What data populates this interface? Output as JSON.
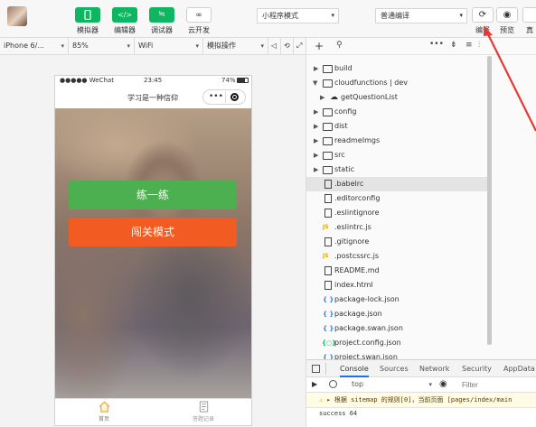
{
  "toolbar": {
    "buttons": [
      {
        "label": "模拟器",
        "icon": "phone-icon"
      },
      {
        "label": "编辑器",
        "icon": "code-icon"
      },
      {
        "label": "调试器",
        "icon": "debug-icon"
      },
      {
        "label": "云开发",
        "icon": "cloud-icon"
      }
    ],
    "mode_select": "小程序模式",
    "compile_select": "普通编译",
    "compile_label": "编译",
    "preview_label": "预览",
    "more_label": "真"
  },
  "subbar": {
    "device": "iPhone 6/...",
    "zoom": "85%",
    "network": "WiFi",
    "operation": "模拟操作"
  },
  "phone": {
    "status": {
      "carrier": "●●●●● WeChat",
      "time": "23:45",
      "battery": "74%"
    },
    "title": "学习是一种信仰",
    "capsule_dots": "•••",
    "buttons": [
      {
        "label": "练一练",
        "color": "#4caf50"
      },
      {
        "label": "闯关模式",
        "color": "#f25b22"
      }
    ],
    "tabs": [
      {
        "label": "首页",
        "icon": "home-icon"
      },
      {
        "label": "答题记录",
        "icon": "record-icon"
      }
    ]
  },
  "filetree": {
    "items": [
      {
        "name": "build",
        "type": "folder"
      },
      {
        "name": "cloudfunctions | dev",
        "type": "cloud-folder",
        "expanded": true
      },
      {
        "name": "getQuestionList",
        "type": "cloud-folder-child"
      },
      {
        "name": "config",
        "type": "folder"
      },
      {
        "name": "dist",
        "type": "folder"
      },
      {
        "name": "readmeImgs",
        "type": "folder"
      },
      {
        "name": "src",
        "type": "folder"
      },
      {
        "name": "static",
        "type": "folder"
      },
      {
        "name": ".babelrc",
        "type": "file",
        "selected": true
      },
      {
        "name": ".editorconfig",
        "type": "file"
      },
      {
        "name": ".eslintignore",
        "type": "file"
      },
      {
        "name": ".eslintrc.js",
        "type": "js"
      },
      {
        "name": ".gitignore",
        "type": "file"
      },
      {
        "name": ".postcssrc.js",
        "type": "js"
      },
      {
        "name": "README.md",
        "type": "file"
      },
      {
        "name": "index.html",
        "type": "file"
      },
      {
        "name": "package-lock.json",
        "type": "json"
      },
      {
        "name": "package.json",
        "type": "json"
      },
      {
        "name": "package.swan.json",
        "type": "json"
      },
      {
        "name": "project.config.json",
        "type": "config-json"
      },
      {
        "name": "project.swan.json",
        "type": "json"
      }
    ]
  },
  "console": {
    "tabs": [
      "Console",
      "Sources",
      "Network",
      "Security",
      "AppData"
    ],
    "context": "top",
    "filter_placeholder": "Filter",
    "warning": "▸ 根据 sitemap 的规则[0]，当前页面 [pages/index/main",
    "log": "success 64"
  },
  "colors": {
    "accent_green": "#0eb662",
    "annotation_red": "#e53935"
  }
}
